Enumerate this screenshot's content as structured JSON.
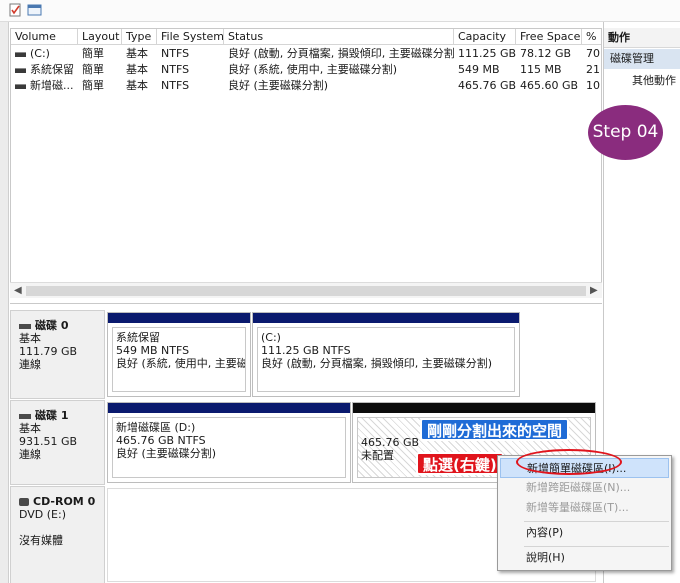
{
  "toolbar": {
    "icons": [
      "checklist-icon",
      "window-icon"
    ]
  },
  "volume_list": {
    "columns": [
      "Volume",
      "Layout",
      "Type",
      "File System",
      "Status",
      "Capacity",
      "Free Space",
      "%"
    ],
    "rows": [
      {
        "volume": "(C:)",
        "layout": "簡單",
        "type": "基本",
        "fs": "NTFS",
        "status": "良好 (啟動, 分頁檔案, 損毀傾印, 主要磁碟分割)",
        "capacity": "111.25 GB",
        "free": "78.12 GB",
        "pct": "70"
      },
      {
        "volume": "系統保留",
        "layout": "簡單",
        "type": "基本",
        "fs": "NTFS",
        "status": "良好 (系統, 使用中, 主要磁碟分割)",
        "capacity": "549 MB",
        "free": "115 MB",
        "pct": "21"
      },
      {
        "volume": "新增磁...",
        "layout": "簡單",
        "type": "基本",
        "fs": "NTFS",
        "status": "良好 (主要磁碟分割)",
        "capacity": "465.76 GB",
        "free": "465.60 GB",
        "pct": "10"
      }
    ]
  },
  "disks": [
    {
      "title": "磁碟 0",
      "type": "基本",
      "size": "111.79 GB",
      "state": "連線"
    },
    {
      "title": "磁碟 1",
      "type": "基本",
      "size": "931.51 GB",
      "state": "連線"
    },
    {
      "title": "CD-ROM 0",
      "type": "DVD (E:)",
      "state": "沒有媒體"
    }
  ],
  "partitions": {
    "d0p1": {
      "name": "系統保留",
      "size": "549 MB NTFS",
      "status": "良好 (系統, 使用中, 主要磁碟"
    },
    "d0p2": {
      "name": "(C:)",
      "size": "111.25 GB NTFS",
      "status": "良好 (啟動, 分頁檔案, 損毀傾印, 主要磁碟分割)"
    },
    "d1p1": {
      "name": "新增磁碟區 (D:)",
      "size": "465.76 GB NTFS",
      "status": "良好 (主要磁碟分割)"
    },
    "d1p2": {
      "size": "465.76 GB",
      "state": "未配置"
    }
  },
  "actions": {
    "header": "動作",
    "disk_mgmt": "磁碟管理",
    "other": "其他動作"
  },
  "step_badge": "Step 04",
  "annotations": {
    "blue": "剛剛分割出來的空間",
    "red": "點選(右鍵)"
  },
  "context_menu": {
    "new_simple": "新增簡單磁碟區(I)...",
    "new_spanned": "新增跨距磁碟區(N)...",
    "new_striped": "新增等量磁碟區(T)...",
    "properties": "內容(P)",
    "help": "說明(H)"
  },
  "colors": {
    "primary_bar": "#0a1a6e",
    "unallocated_bar": "#0c0c0c",
    "selection": "#d9e4f1",
    "badge": "#8a2c7e",
    "blue_label": "#1e6bd6",
    "red_label": "#e0141c"
  }
}
